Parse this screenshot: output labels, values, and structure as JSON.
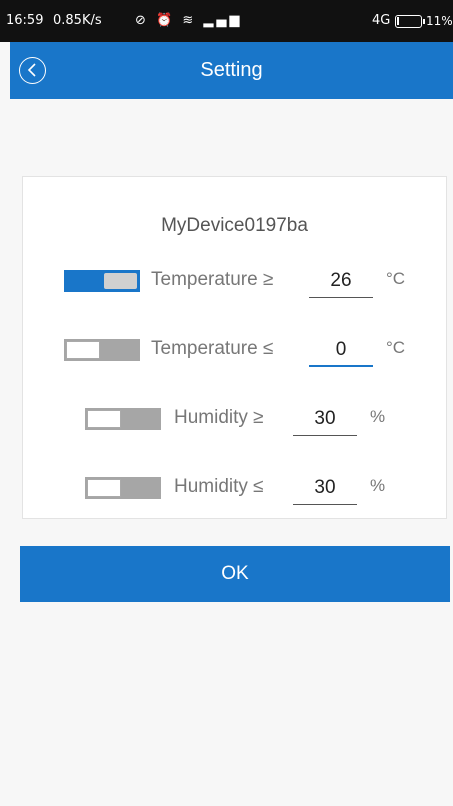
{
  "status_bar": {
    "time": "16:59",
    "speed": "0.85K/s",
    "network": "4G",
    "battery": "11%",
    "battery_level": 0.11
  },
  "header": {
    "title": "Setting"
  },
  "device": {
    "name": "MyDevice0197ba"
  },
  "settings": [
    {
      "label": "Temperature ≥",
      "value": "26",
      "unit": "°C",
      "enabled": true
    },
    {
      "label": "Temperature ≤",
      "value": "0",
      "unit": "°C",
      "enabled": false
    },
    {
      "label": "Humidity ≥",
      "value": "30",
      "unit": "%",
      "enabled": false
    },
    {
      "label": "Humidity ≤",
      "value": "30",
      "unit": "%",
      "enabled": false
    }
  ],
  "actions": {
    "ok_label": "OK"
  },
  "colors": {
    "accent": "#1976c9",
    "toggle_off": "#a6a6a6",
    "status_bar": "#111111"
  }
}
